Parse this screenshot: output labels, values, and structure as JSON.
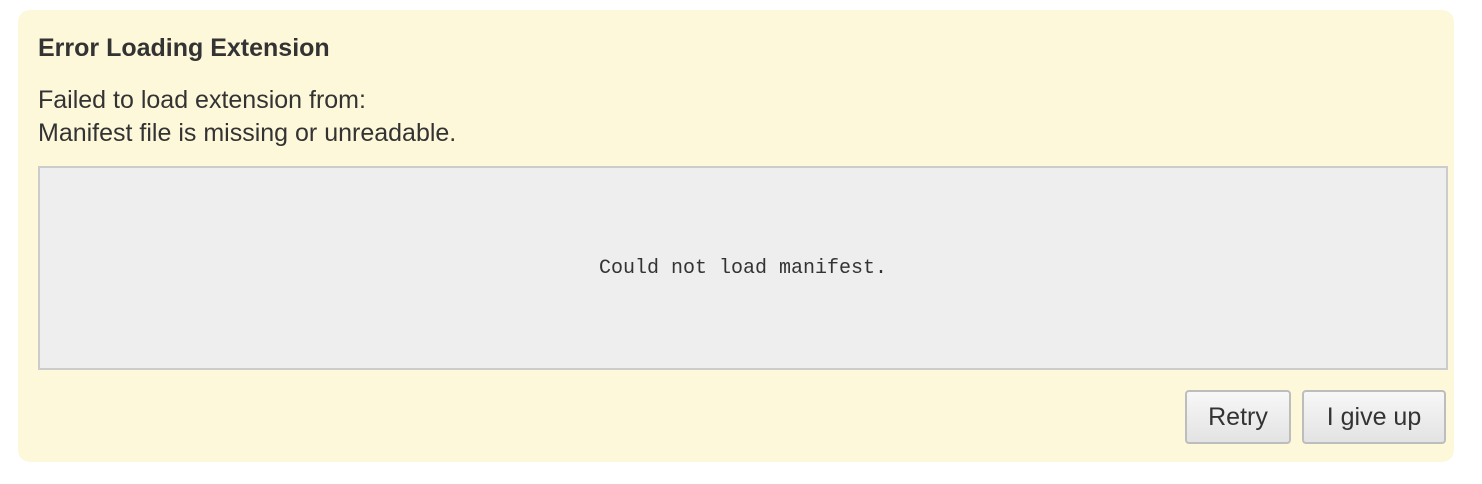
{
  "dialog": {
    "title": "Error Loading Extension",
    "message_lines": [
      "Failed to load extension from:",
      "Manifest file is missing or unreadable."
    ],
    "details_text": "Could not load manifest.",
    "buttons": {
      "retry_label": "Retry",
      "give_up_label": "I give up"
    }
  },
  "colors": {
    "panel_background": "#fdf8da",
    "details_background": "#eeeeee",
    "text": "#333333"
  }
}
